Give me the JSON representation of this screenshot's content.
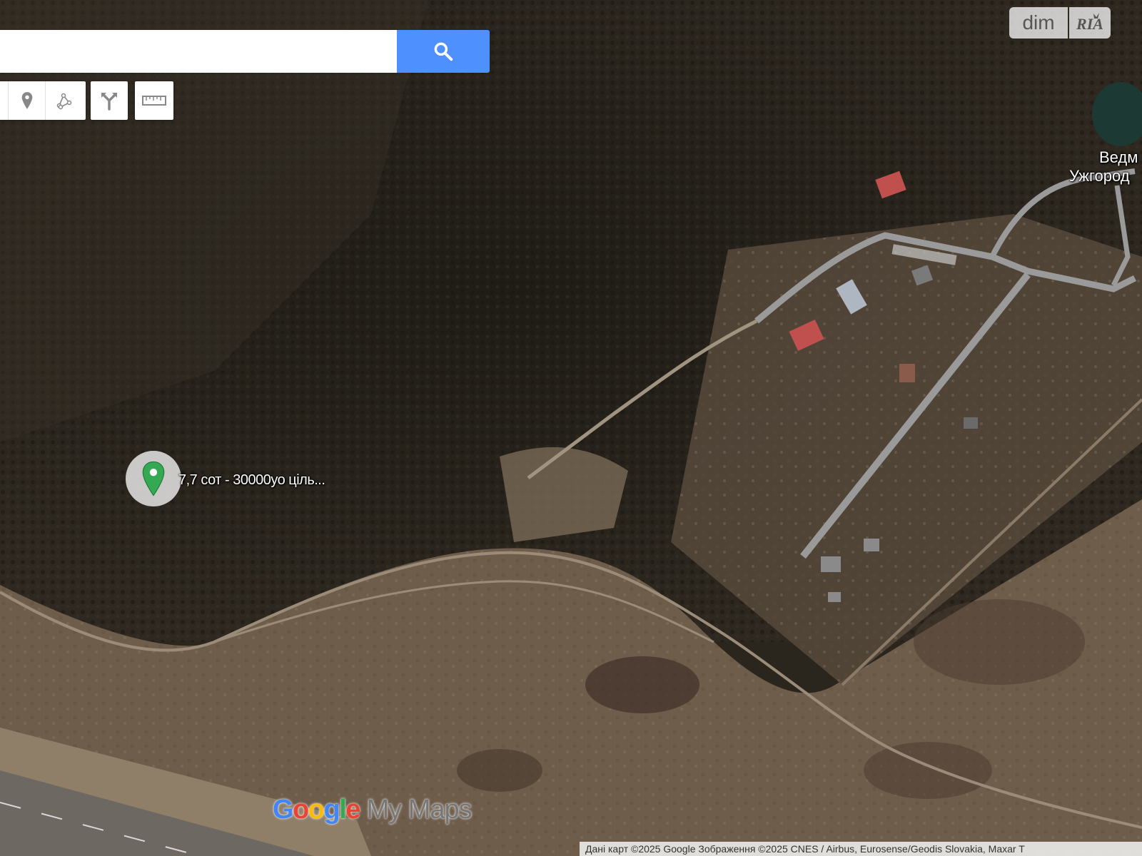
{
  "search": {
    "value": "",
    "placeholder": ""
  },
  "toolbar": {
    "tools": [
      {
        "name": "hand-tool",
        "icon": "hand-icon"
      },
      {
        "name": "add-marker",
        "icon": "marker-icon"
      },
      {
        "name": "draw-line",
        "icon": "draw-line-icon"
      },
      {
        "name": "add-directions",
        "icon": "directions-icon"
      },
      {
        "name": "measure-distance",
        "icon": "ruler-icon"
      }
    ]
  },
  "logo": {
    "left": "dim",
    "right": "RIA"
  },
  "marker": {
    "label": "7,7 сот - 30000уо ціль...",
    "color": "#34a853"
  },
  "place_label": {
    "line1": "Ведм",
    "line2": "Ужгород"
  },
  "watermark": {
    "google": "Google",
    "suffix": " My Maps"
  },
  "attribution": "Дані карт ©2025 Google Зображення ©2025 CNES / Airbus, Eurosense/Geodis Slovakia, Maxar T",
  "colors": {
    "search_button": "#4d90fe",
    "marker": "#34a853"
  }
}
